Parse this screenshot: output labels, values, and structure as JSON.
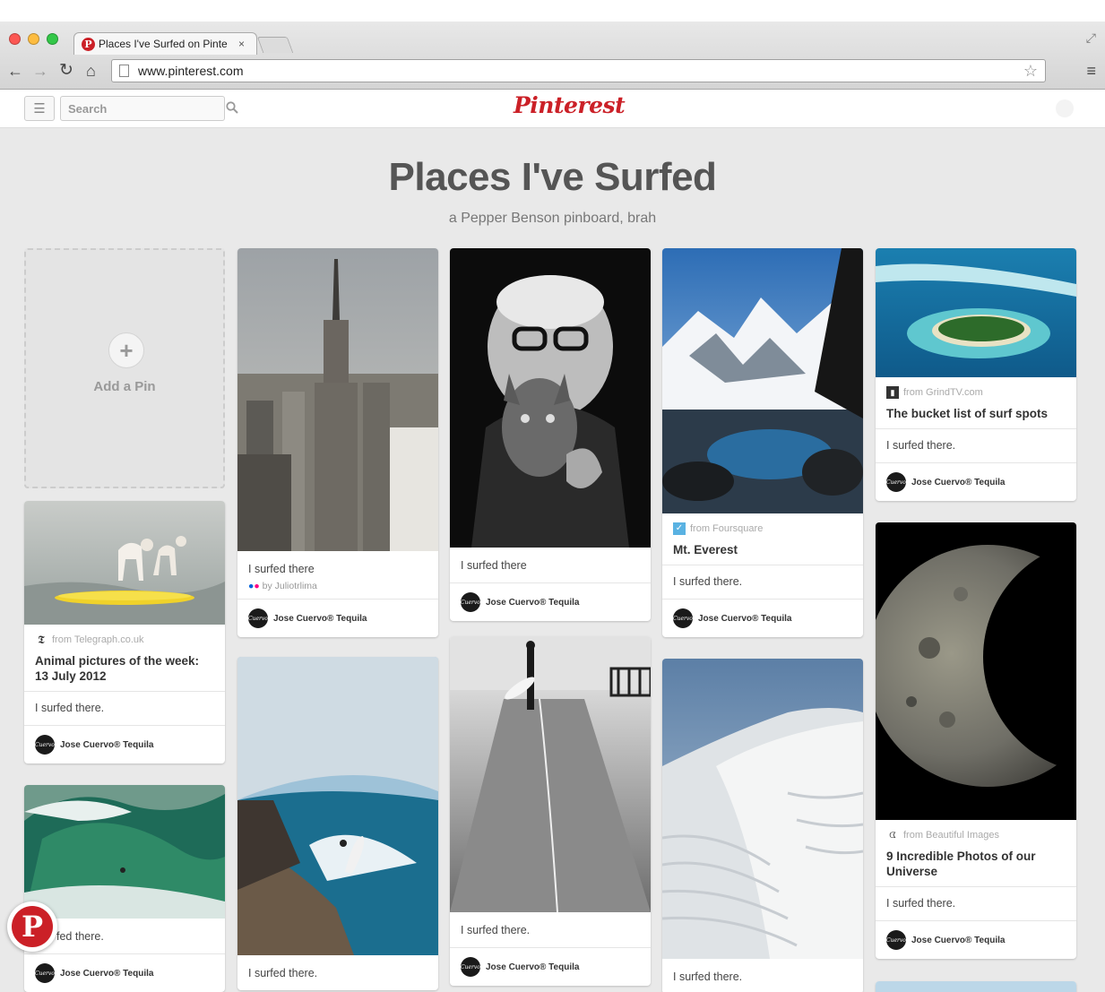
{
  "browser": {
    "tab_title": "Places I've Surfed on Pinte",
    "tab_close": "×",
    "url": "www.pinterest.com"
  },
  "header": {
    "search_placeholder": "Search",
    "logo": "Pinterest"
  },
  "board": {
    "title": "Places I've Surfed",
    "subtitle": "a Pepper Benson pinboard, brah",
    "add_pin_label": "Add a Pin"
  },
  "pins": {
    "c1_dogs": {
      "source": "from Telegraph.co.uk",
      "title": "Animal pictures of the week: 13 July 2012",
      "desc": "I surfed there.",
      "user": "Jose Cuervo® Tequila"
    },
    "c1_wave": {
      "desc": "fed there.",
      "user": "Jose Cuervo® Tequila"
    },
    "c2_nyc": {
      "desc": "I surfed there",
      "via": "by Juliotrlima",
      "user": "Jose Cuervo® Tequila"
    },
    "c2_cliff": {
      "desc": "I surfed there."
    },
    "c3_lady": {
      "desc": "I surfed there",
      "user": "Jose Cuervo® Tequila"
    },
    "c3_road": {
      "desc": "I surfed there.",
      "user": "Jose Cuervo® Tequila"
    },
    "c4_everest": {
      "source": "from Foursquare",
      "title": "Mt. Everest",
      "desc": "I surfed there.",
      "user": "Jose Cuervo® Tequila"
    },
    "c4_dune": {
      "desc": "I surfed there."
    },
    "c5_island": {
      "source": "from GrindTV.com",
      "title": "The bucket list of surf spots",
      "desc": "I surfed there.",
      "user": "Jose Cuervo® Tequila"
    },
    "c5_moon": {
      "source": "from Beautiful Images",
      "title": "9 Incredible Photos of our Universe",
      "desc": "I surfed there.",
      "user": "Jose Cuervo® Tequila"
    }
  },
  "icons": {
    "back": "back-arrow-icon",
    "forward": "forward-arrow-icon",
    "reload": "reload-icon",
    "home": "home-icon",
    "star": "bookmark-star-icon",
    "menu": "menu-icon",
    "search": "search-icon",
    "plus": "plus-icon"
  },
  "colors": {
    "brand_red": "#cb2027",
    "board_bg": "#e9e9e9"
  }
}
